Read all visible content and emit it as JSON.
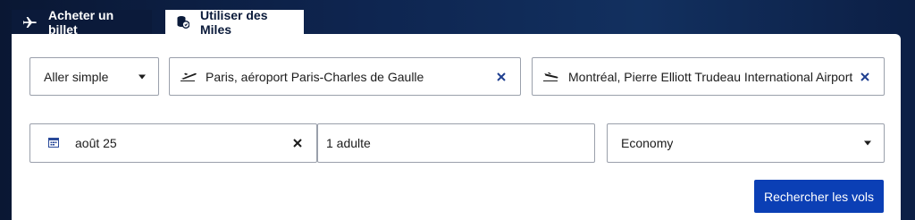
{
  "tabs": {
    "buy": {
      "label": "Acheter un billet",
      "icon": "airplane-icon"
    },
    "miles": {
      "label": "Utiliser des Miles",
      "icon": "miles-coins-icon"
    }
  },
  "form": {
    "trip_type": {
      "value": "Aller simple"
    },
    "origin": {
      "value": "Paris, aéroport Paris-Charles de Gaulle",
      "icon": "plane-takeoff-icon"
    },
    "destination": {
      "value": "Montréal, Pierre Elliott Trudeau International Airport",
      "icon": "plane-landing-icon"
    },
    "date": {
      "value": "août 25",
      "icon": "calendar-icon"
    },
    "passengers": {
      "value": "1 adulte"
    },
    "cabin": {
      "value": "Economy"
    },
    "search_label": "Rechercher les vols"
  },
  "colors": {
    "primary": "#0b3fb5",
    "header_bg": "#0b1a3a",
    "clear_icon": "#1f3f8f"
  }
}
